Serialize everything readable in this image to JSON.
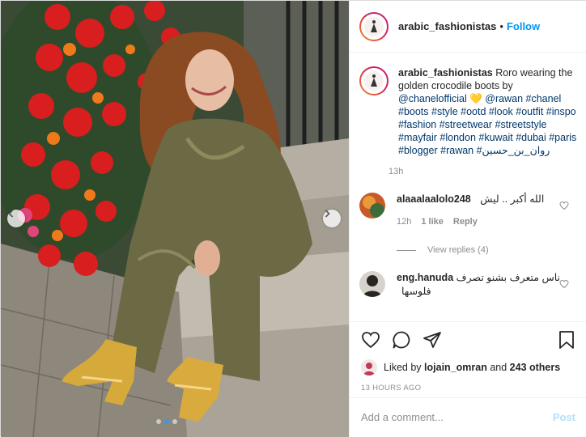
{
  "post": {
    "username": "arabic_fashionistas",
    "follow_label": "Follow",
    "header_separator": "•",
    "caption": {
      "username": "arabic_fashionistas",
      "text_1": "Roro wearing the golden crocodile boots by",
      "mention_1": "@chanelofficial",
      "emoji": "💛",
      "mention_2": "@rawan",
      "hashtags": "#chanel #boots #style #ootd #look #outfit #inspo #fashion #streetwear #streetstyle #mayfair #london #kuwait #dubai #paris #blogger #rawan #روان_بن_حسين",
      "time": "13h"
    },
    "comments": [
      {
        "username": "alaaalaalolo248",
        "text": "الله أكبر .. ليش",
        "time": "12h",
        "likes": "1 like",
        "reply_label": "Reply",
        "view_replies": "View replies (4)"
      },
      {
        "username": "eng.hanuda",
        "text": "ناس متعرف بشنو تصرف فلوسها"
      }
    ],
    "liked_by": {
      "prefix": "Liked by",
      "user": "lojain_omran",
      "and": "and",
      "others": "243 others"
    },
    "time_ago": "13 HOURS AGO",
    "add_comment_placeholder": "Add a comment...",
    "post_label": "Post"
  },
  "carousel": {
    "dot_count": 3,
    "active_dot": 1
  },
  "colors": {
    "follow_blue": "#0095f6",
    "tag_blue": "#00376b",
    "muted": "#8e8e8e",
    "post_disabled": "#b2dffc"
  }
}
